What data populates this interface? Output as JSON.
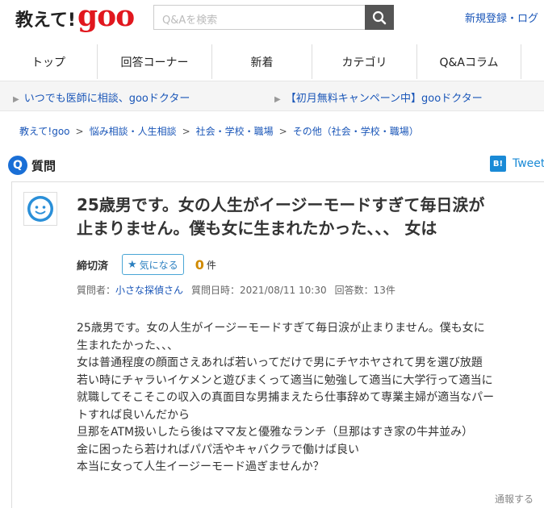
{
  "header": {
    "logo_text": "教えて!",
    "logo_brand": "goo",
    "search_placeholder": "Q&Aを検索",
    "links": "新規登録・ログ"
  },
  "nav": {
    "items": [
      {
        "label": "トップ"
      },
      {
        "label": "回答コーナー"
      },
      {
        "label": "新着"
      },
      {
        "label": "カテゴリ"
      },
      {
        "label": "Q&Aコラム"
      }
    ]
  },
  "promo": {
    "left": "いつでも医師に相談、gooドクター",
    "right": "【初月無料キャンペーン中】gooドクター"
  },
  "breadcrumb": {
    "items": [
      "教えて!goo",
      "悩み相談・人生相談",
      "社会・学校・職場",
      "その他（社会・学校・職場）"
    ],
    "sep": ">"
  },
  "question": {
    "badge": "Q",
    "label": "質問",
    "share_hatena": "B!",
    "share_tweet": "Tweet",
    "title_line1": "25歳男です。女の人生がイージーモードすぎて毎日涙が",
    "title_line2": "止まりません。僕も女に生まれたかった、、、 女は",
    "status": "締切済",
    "follow_label": "気になる",
    "follow_count": "0",
    "follow_unit": "件",
    "meta_asker_label": "質問者：",
    "meta_asker": "小さな探偵さん",
    "meta_date": "質問日時：2021/08/11 10:30",
    "meta_answers": "回答数：13件",
    "body": [
      "25歳男です。女の人生がイージーモードすぎて毎日涙が止まりません。僕も女に",
      "生まれたかった、、、",
      "女は普通程度の顔面さえあれば若いってだけで男にチヤホヤされて男を選び放題",
      "若い時にチャラいイケメンと遊びまくって適当に勉強して適当に大学行って適当に",
      "就職してそこそこの収入の真面目な男捕まえたら仕事辞めて専業主婦が適当なパー",
      "トすれば良いんだから",
      "旦那をATM扱いしたら後はママ友と優雅なランチ（旦那はすき家の牛丼並み）",
      "金に困ったら若ければパパ活やキャバクラで働けば良い",
      "本当に女って人生イージーモード過ぎませんか？"
    ],
    "report": "通報する"
  },
  "colors": {
    "brand": "#e1171e",
    "link": "#1a56b8",
    "accent": "#1a6fd6",
    "count": "#d08a00"
  }
}
